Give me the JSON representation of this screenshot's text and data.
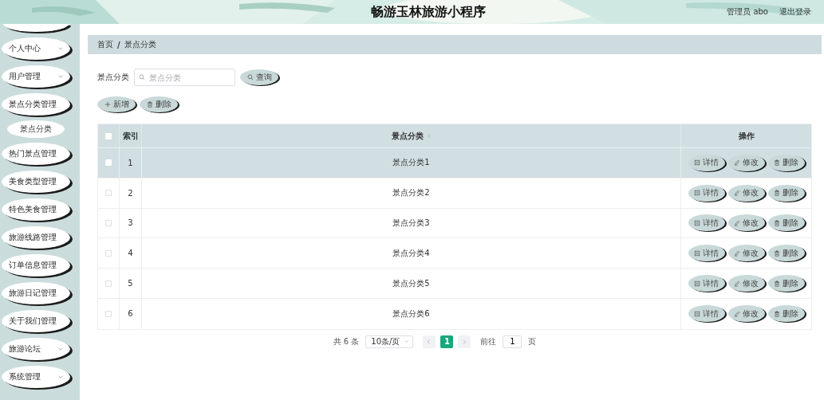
{
  "header": {
    "title": "畅游玉林旅游小程序",
    "user": "管理员 abo",
    "logout": "退出登录"
  },
  "sidebar": {
    "items": [
      {
        "kind": "cut"
      },
      {
        "label": "个人中心",
        "kind": "dropdown"
      },
      {
        "label": "用户管理",
        "kind": "dropdown"
      },
      {
        "label": "景点分类管理",
        "kind": "plain",
        "children": [
          {
            "label": "景点分类"
          }
        ]
      },
      {
        "label": "热门景点管理",
        "kind": "plain"
      },
      {
        "label": "美食类型管理",
        "kind": "plain"
      },
      {
        "label": "特色美食管理",
        "kind": "plain"
      },
      {
        "label": "旅游线路管理",
        "kind": "plain"
      },
      {
        "label": "订单信息管理",
        "kind": "plain"
      },
      {
        "label": "旅游日记管理",
        "kind": "plain"
      },
      {
        "label": "关于我们管理",
        "kind": "plain"
      },
      {
        "label": "旅游论坛",
        "kind": "dropdown"
      },
      {
        "label": "系统管理",
        "kind": "dropdown"
      }
    ]
  },
  "breadcrumb": {
    "items": [
      "首页",
      "景点分类"
    ],
    "separator": "/"
  },
  "search": {
    "label": "景点分类",
    "placeholder": "景点分类",
    "button": "查询"
  },
  "actions": [
    "新增",
    "删除"
  ],
  "table": {
    "columns": [
      "索引",
      "景点分类",
      "操作"
    ],
    "header_checked": false,
    "rows": [
      {
        "index": "1",
        "name": "景点分类1",
        "checked": false,
        "highlighted": true,
        "buttons": [
          {
            "kind": "detail",
            "label": "详情"
          },
          {
            "kind": "edit",
            "label": "修改"
          },
          {
            "kind": "delete",
            "label": "删除"
          }
        ]
      },
      {
        "index": "2",
        "name": "景点分类2",
        "checked": false,
        "highlighted": false,
        "buttons": [
          {
            "kind": "detail",
            "label": "详情"
          },
          {
            "kind": "edit",
            "label": "修改"
          },
          {
            "kind": "delete",
            "label": "删除"
          }
        ]
      },
      {
        "index": "3",
        "name": "景点分类3",
        "checked": false,
        "highlighted": false,
        "buttons": [
          {
            "kind": "detail",
            "label": "详情"
          },
          {
            "kind": "edit",
            "label": "修改"
          },
          {
            "kind": "delete",
            "label": "删除"
          }
        ]
      },
      {
        "index": "4",
        "name": "景点分类4",
        "checked": false,
        "highlighted": false,
        "buttons": [
          {
            "kind": "detail",
            "label": "详情"
          },
          {
            "kind": "edit",
            "label": "修改"
          },
          {
            "kind": "delete",
            "label": "删除"
          }
        ]
      },
      {
        "index": "5",
        "name": "景点分类5",
        "checked": false,
        "highlighted": false,
        "buttons": [
          {
            "kind": "detail",
            "label": "详情"
          },
          {
            "kind": "edit",
            "label": "修改"
          },
          {
            "kind": "delete",
            "label": "删除"
          }
        ]
      },
      {
        "index": "6",
        "name": "景点分类6",
        "checked": false,
        "highlighted": false,
        "buttons": [
          {
            "kind": "detail",
            "label": "详情"
          },
          {
            "kind": "edit",
            "label": "修改"
          },
          {
            "kind": "delete",
            "label": "删除"
          }
        ]
      }
    ]
  },
  "pagination": {
    "total": "共 6 条",
    "page_size": "10条/页",
    "pages": [
      {
        "label": "1",
        "selected": true
      }
    ],
    "goto_label": "前往",
    "goto_value": "1",
    "goto_suffix": "页"
  }
}
